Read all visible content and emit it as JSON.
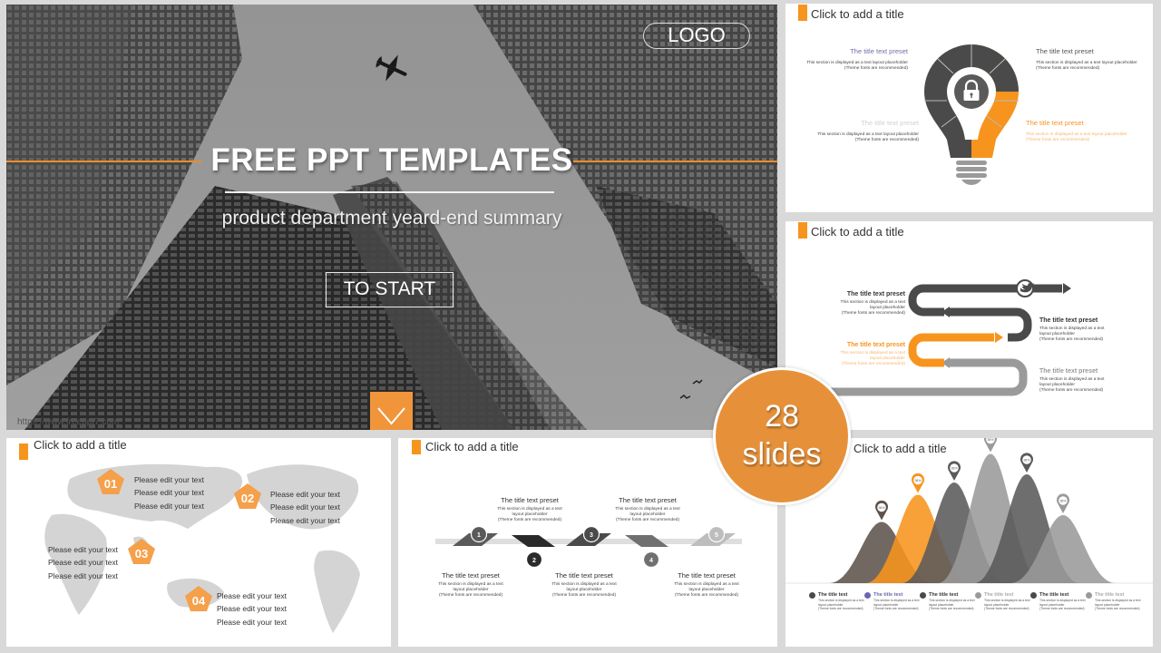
{
  "hero": {
    "logo": "LOGO",
    "title": "FREE PPT TEMPLATES",
    "subtitle": "product department yeard-end summary",
    "start_button": "TO START",
    "watermark": "https://www.freeppt7.com"
  },
  "badge": {
    "count": "28",
    "label": "slides"
  },
  "colors": {
    "accent": "#f7941d",
    "dark": "#4a4a4a",
    "mid": "#6b6b6b",
    "light": "#9a9a9a",
    "bubble": "#e6913a"
  },
  "slide_bulb": {
    "title": "Click to add a title",
    "icon": "lock-icon",
    "blocks": [
      {
        "heading": "The title text preset",
        "body1": "This section is displayed as a text layout placeholder",
        "body2": "(Theme fonts are recommended)"
      },
      {
        "heading": "The title text preset",
        "body1": "This section is displayed as a text layout placeholder",
        "body2": "(Theme fonts are recommended)"
      },
      {
        "heading": "The title text preset",
        "body1": "This section is displayed as a text layout placeholder",
        "body2": "(Theme fonts are recommended)"
      },
      {
        "heading": "The title text preset",
        "body1": "This section is displayed as a text layout placeholder",
        "body2": "(Theme fonts are recommended)"
      }
    ]
  },
  "slide_snake": {
    "title": "Click to add a title",
    "icon": "twitter-bird-icon",
    "blocks": [
      {
        "heading": "The title text preset",
        "body1": "This section is displayed as a text",
        "body2": "layout placeholder",
        "body3": "(Theme fonts are recommended)"
      },
      {
        "heading": "The title text preset",
        "body1": "This section is displayed as a text",
        "body2": "layout placeholder",
        "body3": "(Theme fonts are recommended)"
      },
      {
        "heading": "The title text preset",
        "body1": "This section is displayed as a text",
        "body2": "layout placeholder",
        "body3": "(Theme fonts are recommended)"
      },
      {
        "heading": "The title text preset",
        "body1": "This section is displayed as a text",
        "body2": "layout placeholder",
        "body3": "(Theme fonts are recommended)"
      }
    ]
  },
  "slide_map": {
    "title": "Click to add a title",
    "markers": [
      {
        "num": "01",
        "lines": [
          "Please edit your text",
          "Please edit your text",
          "Please edit your text"
        ]
      },
      {
        "num": "02",
        "lines": [
          "Please edit your text",
          "Please edit your text",
          "Please edit your text"
        ]
      },
      {
        "num": "03",
        "lines": [
          "Please edit your text",
          "Please edit your text",
          "Please edit your text"
        ]
      },
      {
        "num": "04",
        "lines": [
          "Please edit your text",
          "Please edit your text",
          "Please edit your text"
        ]
      }
    ]
  },
  "slide_steps": {
    "title": "Click to add a title",
    "steps": [
      {
        "num": "1",
        "heading": "The title text preset",
        "body1": "This section is displayed as a text",
        "body2": "layout placeholder",
        "body3": "(Theme fonts are recommended)"
      },
      {
        "num": "2",
        "heading": "The title text preset",
        "body1": "This section is displayed as a text",
        "body2": "layout placeholder",
        "body3": "(Theme fonts are recommended)"
      },
      {
        "num": "3",
        "heading": "The title text preset",
        "body1": "This section is displayed as a text",
        "body2": "layout placeholder",
        "body3": "(Theme fonts are recommended)"
      },
      {
        "num": "4",
        "heading": "The title text preset",
        "body1": "This section is displayed as a text",
        "body2": "layout placeholder",
        "body3": "(Theme fonts are recommended)"
      },
      {
        "num": "5",
        "heading": "The title text preset",
        "body1": "This section is displayed as a text",
        "body2": "layout placeholder",
        "body3": "(Theme fonts are recommended)"
      }
    ]
  },
  "slide_peaks": {
    "title": "Click to add a title",
    "pin_label": "36%",
    "peaks": [
      {
        "relative_height": 0.45,
        "color": "#5e534c"
      },
      {
        "relative_height": 0.65,
        "color": "#f7941d"
      },
      {
        "relative_height": 0.74,
        "color": "#5a5a5a"
      },
      {
        "relative_height": 0.95,
        "color": "#9a9a9a"
      },
      {
        "relative_height": 0.8,
        "color": "#5a5a5a"
      },
      {
        "relative_height": 0.5,
        "color": "#9a9a9a"
      }
    ],
    "legend": [
      {
        "label": "The title text",
        "dot": "#4a4a4a",
        "text_color": "#333333",
        "body1": "This section is displayed as a text",
        "body2": "layout placeholder",
        "body3": "(Theme fonts are recommended)"
      },
      {
        "label": "The title text",
        "dot": "#6a67b0",
        "text_color": "#6a67b0",
        "body1": "This section is displayed as a text",
        "body2": "layout placeholder",
        "body3": "(Theme fonts are recommended)"
      },
      {
        "label": "The title text",
        "dot": "#4a4a4a",
        "text_color": "#333333",
        "body1": "This section is displayed as a text",
        "body2": "layout placeholder",
        "body3": "(Theme fonts are recommended)"
      },
      {
        "label": "The title text",
        "dot": "#9a9a9a",
        "text_color": "#aaaaaa",
        "body1": "This section is displayed as a text",
        "body2": "layout placeholder",
        "body3": "(Theme fonts are recommended)"
      },
      {
        "label": "The title text",
        "dot": "#4a4a4a",
        "text_color": "#333333",
        "body1": "This section is displayed as a text",
        "body2": "layout placeholder",
        "body3": "(Theme fonts are recommended)"
      },
      {
        "label": "The title text",
        "dot": "#9a9a9a",
        "text_color": "#aaaaaa",
        "body1": "This section is displayed as a text",
        "body2": "layout placeholder",
        "body3": "(Theme fonts are recommended)"
      }
    ]
  }
}
